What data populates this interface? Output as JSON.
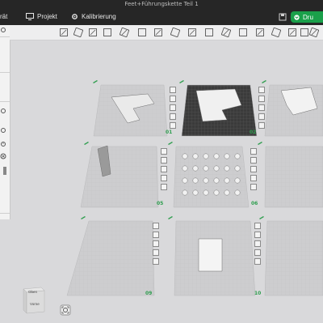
{
  "window": {
    "title": "Feet+Führungskette Teil 1"
  },
  "menubar": {
    "left_cut": "rät",
    "tabs": [
      {
        "label": "Projekt"
      },
      {
        "label": "Kalibrierung"
      }
    ],
    "print_button": "Dru"
  },
  "toolbar": {
    "icons": [
      "add-object-icon",
      "grid-arrange-icon",
      "plate-icon",
      "layers-icon",
      "placeholder-icon",
      "move-icon",
      "rotate-icon",
      "scale-icon",
      "lay-on-face-icon",
      "cut-icon",
      "boolean-icon",
      "support-paint-icon",
      "seam-paint-icon",
      "color-paint-icon",
      "text-icon",
      "measure-icon",
      "assembly-icon"
    ]
  },
  "plates": [
    {
      "number": "01",
      "style": "light"
    },
    {
      "number": "02",
      "style": "textured-dark"
    },
    {
      "number": "",
      "style": "light"
    },
    {
      "number": "",
      "style": "light"
    },
    {
      "number": "05",
      "style": "light"
    },
    {
      "number": "06",
      "style": "light"
    },
    {
      "number": "",
      "style": "light"
    },
    {
      "number": "09",
      "style": "light"
    },
    {
      "number": "10",
      "style": "light"
    }
  ],
  "viewcube": {
    "top": "Oben",
    "front": "Vorne"
  },
  "colors": {
    "accent": "#1aa04a",
    "plate_number": "#2f9e4f",
    "chrome": "#262626"
  }
}
